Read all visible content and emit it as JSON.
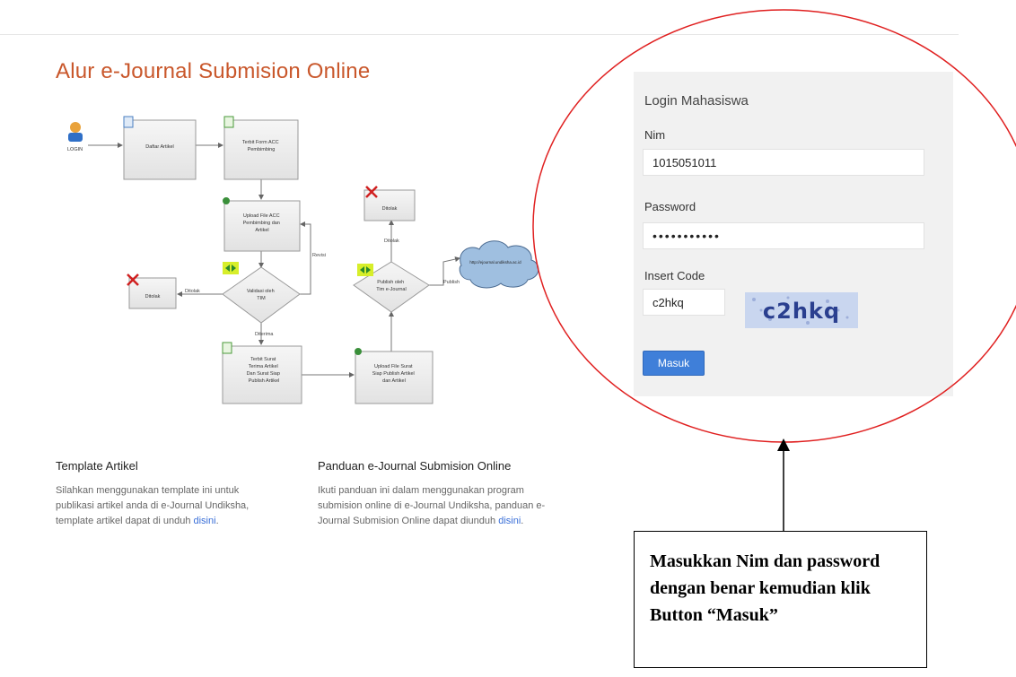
{
  "page": {
    "title": "Alur e-Journal Submision Online"
  },
  "flowchart": {
    "login": "LOGIN",
    "daftar_artikel": "Daftar Artikel",
    "terbit_form": [
      "Terbit Form ACC",
      "Pembimbing"
    ],
    "upload_file": [
      "Upload File ACC",
      "Pembimbing dan",
      "Artikel"
    ],
    "validasi": [
      "Validasi oleh",
      "TIM"
    ],
    "revisi": "Revisi",
    "ditolak_box": "Ditolak",
    "ditolak_edge": "Ditolak",
    "diterima": "Diterima",
    "terbit_surat": [
      "Terbit Surat",
      "Terima Artikel",
      "Dan Surat Siap",
      "Publish Artikel"
    ],
    "upload_surat": [
      "Upload File Surat",
      "Siap Publish Artikel",
      "dan Artikel"
    ],
    "publish_decision": [
      "Publish oleh",
      "Tim e-Journal"
    ],
    "ditolak_box_2": "Ditolak",
    "ditolak_edge_2": "Ditolak",
    "publish_edge": "Publish",
    "cloud_label": "http://ejournal.undiksha.ac.id"
  },
  "template_section": {
    "title": "Template Artikel",
    "text": "Silahkan menggunakan template ini untuk publikasi artikel anda di e-Journal Undiksha, template artikel dapat di unduh",
    "link": "disini"
  },
  "panduan_section": {
    "title": "Panduan e-Journal Submision Online",
    "text": "Ikuti panduan ini dalam menggunakan program submision online di e-Journal Undiksha, panduan e-Journal Submision Online dapat diunduh",
    "link": "disini"
  },
  "login": {
    "title": "Login Mahasiswa",
    "nim_label": "Nim",
    "nim_value": "1015051011",
    "password_label": "Password",
    "password_value": "•••••••••••",
    "code_label": "Insert Code",
    "code_value": "c2hkq",
    "captcha_text": "c2hkq",
    "submit_label": "Masuk"
  },
  "annotation": {
    "callout_text": "Masukkan Nim dan password dengan benar kemudian klik Button “Masuk”",
    "circle_color": "#e02020"
  },
  "colors": {
    "title": "#c9572b",
    "button": "#3f7fd9",
    "link": "#3a6fd8",
    "panel": "#f1f1f1"
  }
}
